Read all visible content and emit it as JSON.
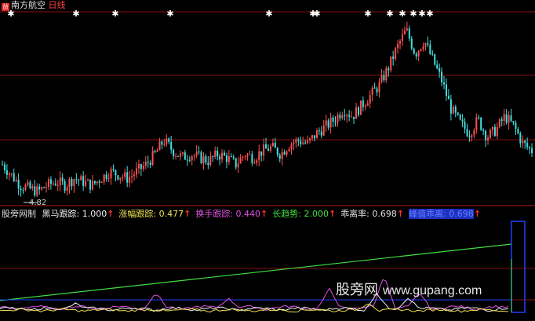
{
  "header": {
    "stock_name": "南方航空",
    "period": "日线",
    "logo_glyph": "益"
  },
  "low_marker": "4.82",
  "indicator": {
    "name": "股旁网制",
    "items": [
      {
        "label": "黑马跟踪",
        "value": "1.000",
        "color": "#f0f0f0"
      },
      {
        "label": "涨幅跟踪",
        "value": "0.477",
        "color": "#f0e050"
      },
      {
        "label": "换手跟踪",
        "value": "0.440",
        "color": "#e050e0"
      },
      {
        "label": "长趋势",
        "value": "2.000",
        "color": "#40e040"
      },
      {
        "label": "乖离率",
        "value": "0.698",
        "color": "#e0e0e0"
      },
      {
        "label": "峰值乖离",
        "value": "0.698",
        "color": "#4060ff"
      }
    ],
    "arrow": "↑"
  },
  "watermark": {
    "text": "股旁网",
    "site": "www.gupang.com"
  },
  "colors": {
    "up": "#ff5050",
    "down": "#40e0e0",
    "grid": "#8a1010",
    "white": "#ffffff"
  },
  "chart_data": {
    "type": "candlestick",
    "title": "",
    "price_marker": 4.82,
    "description_series": [
      {
        "name": "close_trend",
        "values": [
          5.6,
          5.3,
          5.0,
          4.9,
          4.82,
          5.0,
          5.1,
          5.0,
          5.2,
          5.1,
          5.0,
          5.2,
          5.4,
          5.3,
          5.2,
          5.4,
          5.6,
          5.9,
          6.3,
          6.0,
          5.8,
          5.9,
          5.8,
          5.7,
          5.9,
          5.8,
          5.6,
          5.9,
          5.8,
          6.0,
          6.1,
          5.9,
          6.2,
          6.3,
          6.2,
          6.5,
          6.7,
          6.9,
          7.2,
          7.0,
          7.3,
          7.6,
          7.9,
          8.4,
          9.0,
          9.5,
          8.8,
          9.2,
          8.6,
          8.0,
          7.2,
          6.8,
          6.5,
          6.9,
          6.4,
          6.6,
          7.0,
          6.7,
          6.2,
          6.0
        ]
      }
    ]
  }
}
